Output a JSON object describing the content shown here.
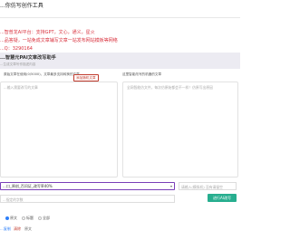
{
  "header": {
    "title": "...你仿写创作工具"
  },
  "promo": {
    "line1": "...智普龙AI平台：支持GPT，文心，通义，星火",
    "line2": "...品答疑，一站免成文章辅写文章一站发布网站模板等网络",
    "line3": "...Q：3290164"
  },
  "section": {
    "title": "...智慧元PAI文章改写助手",
    "subtitle": "...生成文章写作描述内容"
  },
  "left_panel": {
    "header": "原始文章在使用(0/5000)，文章最多支持转换的文章",
    "add_button": "添加随机文章",
    "placeholder": "...输入需要改写的文章"
  },
  "right_panel": {
    "header": "这里智能改写的机器的文章",
    "placeholder": "全网智能仿文件，每次仿原始都会不一样！仿原写出原因"
  },
  "controls": {
    "combo_value": "...口_原创_百问证_改写率40%",
    "combo_arrow": "▾",
    "name_placeholder": "请输入(模拟机) 没有请留空",
    "custom_placeholder": "...指定的字数",
    "generate_label": "进行AI改写"
  },
  "radios": [
    {
      "label": "原文",
      "selected": true
    },
    {
      "label": "标题",
      "selected": false
    },
    {
      "label": "全部",
      "selected": false
    }
  ],
  "tools": [
    {
      "label": "...复制",
      "color": "#2d7ff9"
    },
    {
      "label": "清除",
      "color": "#c0392b"
    },
    {
      "label": "原文",
      "color": "#666666"
    }
  ]
}
